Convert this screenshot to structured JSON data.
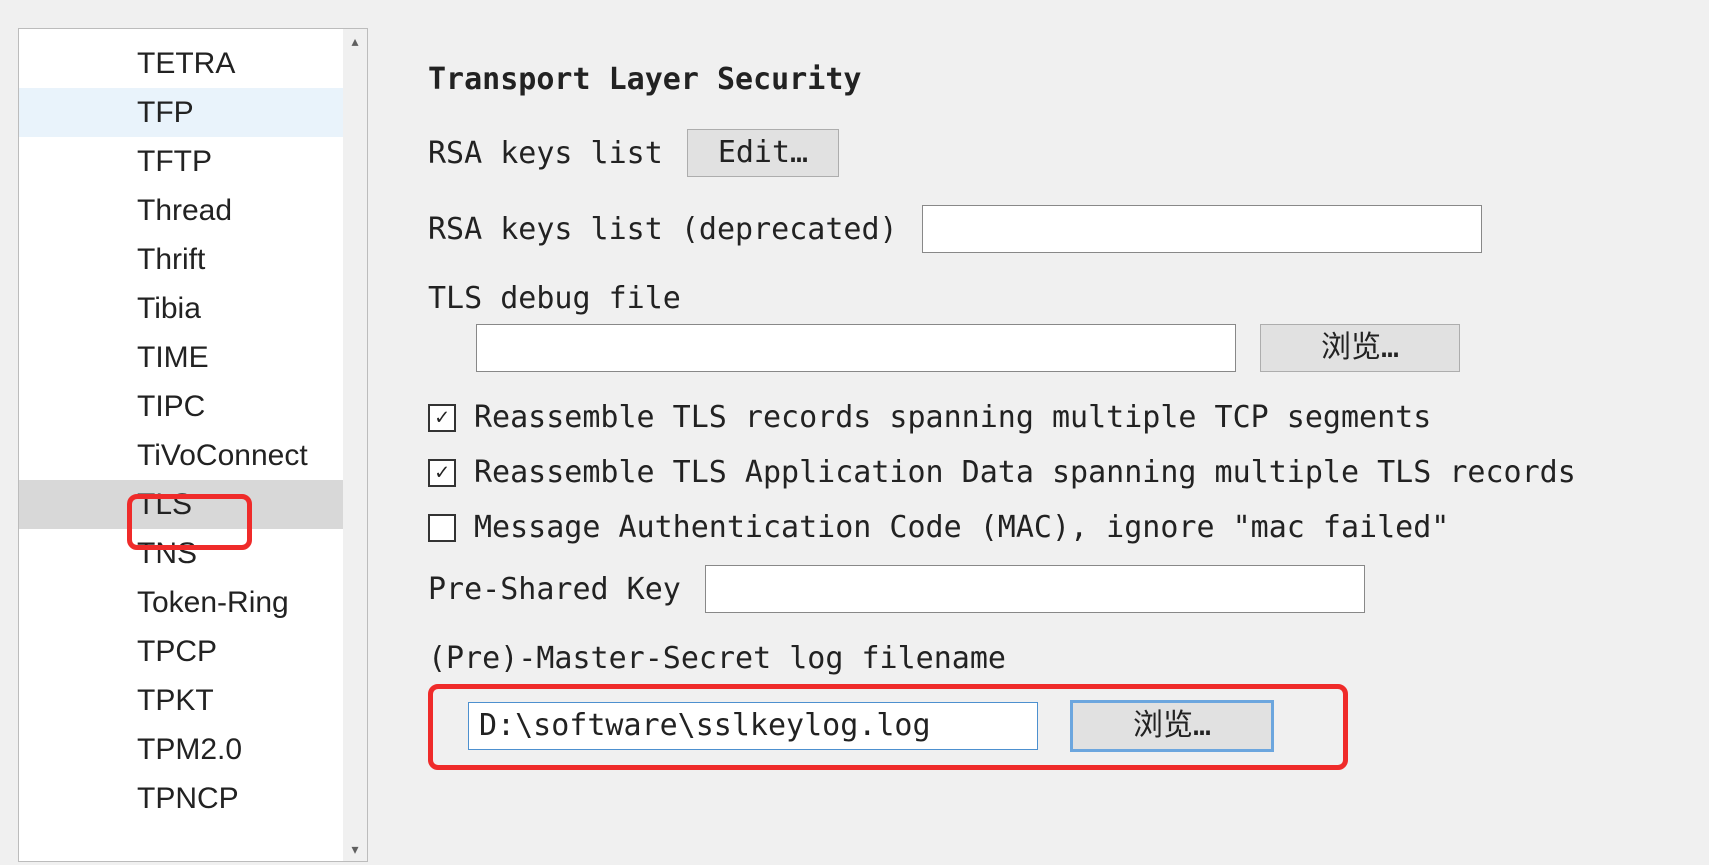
{
  "sidebar": {
    "items": [
      {
        "label": "TETRA"
      },
      {
        "label": "TFP",
        "hover": true
      },
      {
        "label": "TFTP"
      },
      {
        "label": "Thread"
      },
      {
        "label": "Thrift"
      },
      {
        "label": "Tibia"
      },
      {
        "label": "TIME"
      },
      {
        "label": "TIPC"
      },
      {
        "label": "TiVoConnect"
      },
      {
        "label": "TLS",
        "selected": true,
        "annotated": true
      },
      {
        "label": "TNS"
      },
      {
        "label": "Token-Ring"
      },
      {
        "label": "TPCP"
      },
      {
        "label": "TPKT"
      },
      {
        "label": "TPM2.0"
      },
      {
        "label": "TPNCP"
      }
    ]
  },
  "pane": {
    "title": "Transport Layer Security",
    "rsa_keys_label": "RSA keys list",
    "edit_button": "Edit…",
    "rsa_deprecated_label": "RSA keys list (deprecated)",
    "rsa_deprecated_value": "",
    "debug_file_label": "TLS debug file",
    "debug_file_value": "",
    "browse_button": "浏览…",
    "chk1_label": "Reassemble TLS records spanning multiple TCP segments",
    "chk1_checked": true,
    "chk2_label": "Reassemble TLS Application Data spanning multiple TLS records",
    "chk2_checked": true,
    "chk3_label": "Message Authentication Code (MAC), ignore \"mac failed\"",
    "chk3_checked": false,
    "psk_label": "Pre-Shared Key",
    "psk_value": "",
    "secret_label": "(Pre)-Master-Secret log filename",
    "secret_value": "D:\\software\\sslkeylog.log",
    "browse2_button": "浏览…"
  }
}
